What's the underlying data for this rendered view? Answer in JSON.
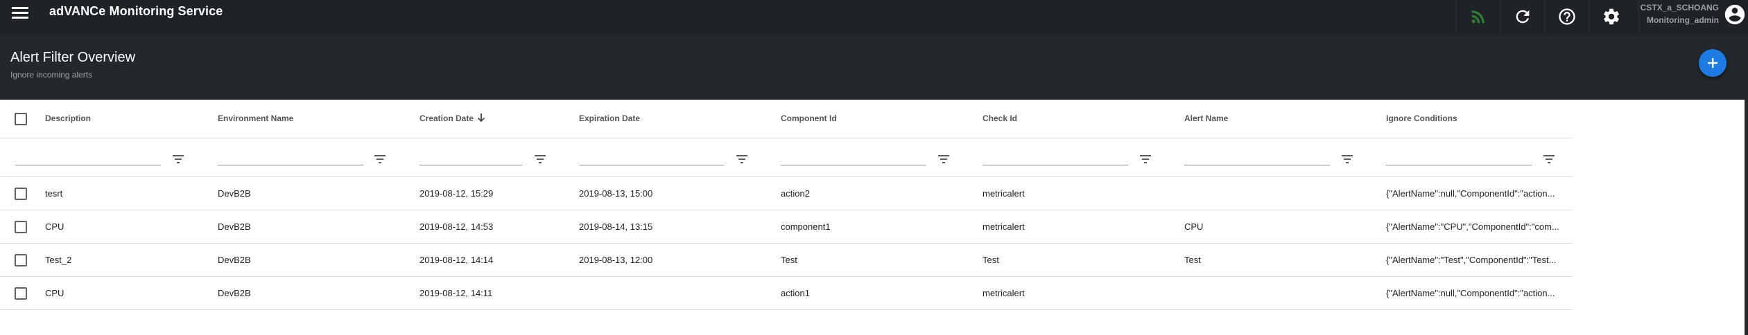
{
  "app": {
    "title": "adVANCe Monitoring Service",
    "user_name": "CSTX_a_SCHOANG",
    "user_role": "Monitoring_admin"
  },
  "toolbar": {
    "icons": [
      "rss-feed-icon",
      "refresh-icon",
      "help-icon",
      "settings-icon",
      "account-icon"
    ],
    "rss_color": "#2e7d32"
  },
  "page": {
    "title": "Alert Filter Overview",
    "subtitle": "Ignore incoming alerts",
    "add_icon": "plus-icon",
    "accent": "#1e7be4"
  },
  "table": {
    "columns": [
      {
        "key": "description",
        "label": "Description"
      },
      {
        "key": "environment",
        "label": "Environment Name"
      },
      {
        "key": "creation",
        "label": "Creation Date",
        "sort": "descending"
      },
      {
        "key": "expiration",
        "label": "Expiration Date"
      },
      {
        "key": "component",
        "label": "Component Id"
      },
      {
        "key": "check",
        "label": "Check Id"
      },
      {
        "key": "alert",
        "label": "Alert Name"
      },
      {
        "key": "ignore",
        "label": "Ignore Conditions"
      }
    ],
    "rows": [
      {
        "description": "tesrt",
        "environment": "DevB2B",
        "creation": "2019-08-12, 15:29",
        "expiration": "2019-08-13, 15:00",
        "component": "action2",
        "check": "metricalert",
        "alert": "",
        "ignore": "{\"AlertName\":null,\"ComponentId\":\"action..."
      },
      {
        "description": "CPU",
        "environment": "DevB2B",
        "creation": "2019-08-12, 14:53",
        "expiration": "2019-08-14, 13:15",
        "component": "component1",
        "check": "metricalert",
        "alert": "CPU",
        "ignore": "{\"AlertName\":\"CPU\",\"ComponentId\":\"com..."
      },
      {
        "description": "Test_2",
        "environment": "DevB2B",
        "creation": "2019-08-12, 14:14",
        "expiration": "2019-08-13, 12:00",
        "component": "Test",
        "check": "Test",
        "alert": "Test",
        "ignore": "{\"AlertName\":\"Test\",\"ComponentId\":\"Test..."
      },
      {
        "description": "CPU",
        "environment": "DevB2B",
        "creation": "2019-08-12, 14:11",
        "expiration": "",
        "component": "action1",
        "check": "metricalert",
        "alert": "",
        "ignore": "{\"AlertName\":null,\"ComponentId\":\"action..."
      }
    ]
  }
}
